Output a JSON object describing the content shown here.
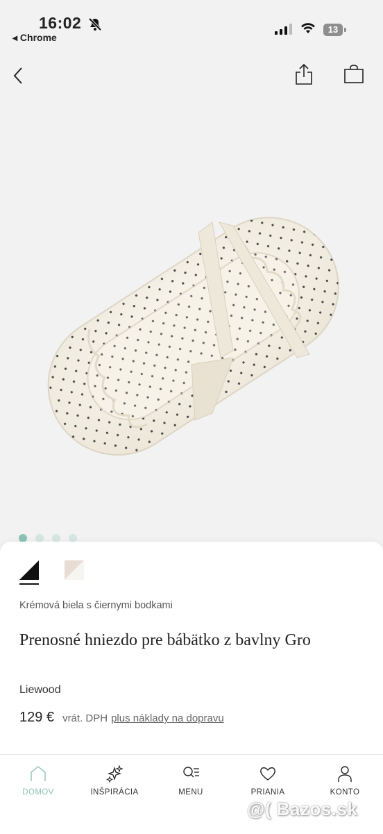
{
  "status": {
    "time": "16:02",
    "back_app": "◂ Chrome",
    "battery": "13"
  },
  "gallery": {
    "image_icon": "baby-nest-product-photo",
    "dot_count": 4,
    "active_dot": 0
  },
  "product": {
    "swatches": [
      {
        "name": "cream-black-dots",
        "colors": [
          "#ffffff",
          "#111111"
        ]
      },
      {
        "name": "sand-white",
        "colors": [
          "#e8ddd4",
          "#f7f5f2"
        ]
      }
    ],
    "variant": "Krémová biela s čiernymi bodkami",
    "title": "Prenosné hniezdo pre bábätko z bavlny Gro",
    "brand": "Liewood",
    "price": "129 €",
    "vat_note": "vrát. DPH",
    "shipping_link": "plus náklady na dopravu"
  },
  "tabbar": {
    "items": [
      {
        "label": "DOMOV",
        "icon": "home-icon",
        "active": true
      },
      {
        "label": "INŠPIRÁCIA",
        "icon": "sparkle-icon",
        "active": false
      },
      {
        "label": "MENU",
        "icon": "search-menu-icon",
        "active": false
      },
      {
        "label": "PRIANIA",
        "icon": "heart-icon",
        "active": false
      },
      {
        "label": "KONTO",
        "icon": "user-icon",
        "active": false
      }
    ]
  },
  "colors": {
    "accent": "#8ec2b6",
    "dot_inactive": "#d5e5e2",
    "background": "#f2f2f2"
  },
  "watermark": "@( Bazos.sk"
}
